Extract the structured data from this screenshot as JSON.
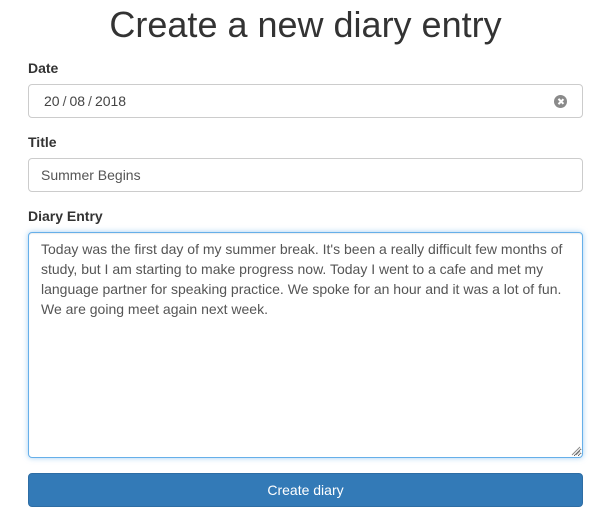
{
  "page": {
    "title": "Create a new diary entry"
  },
  "form": {
    "date": {
      "label": "Date",
      "day": "20",
      "month": "08",
      "year": "2018",
      "separator": "/"
    },
    "title": {
      "label": "Title",
      "value": "Summer Begins"
    },
    "entry": {
      "label": "Diary Entry",
      "value": "Today was the first day of my summer break. It's been a really difficult few months of study, but I am starting to make progress now. Today I went to a cafe and met my language partner for speaking practice. We spoke for an hour and it was a lot of fun. We are going meet again next week."
    },
    "submit_label": "Create diary"
  },
  "colors": {
    "primary": "#337ab7",
    "focus_border": "#66afe9",
    "input_border": "#cccccc",
    "text": "#333333"
  },
  "icons": {
    "date_clear": "clear-circle-icon",
    "textarea_resize": "resize-grip-icon"
  }
}
